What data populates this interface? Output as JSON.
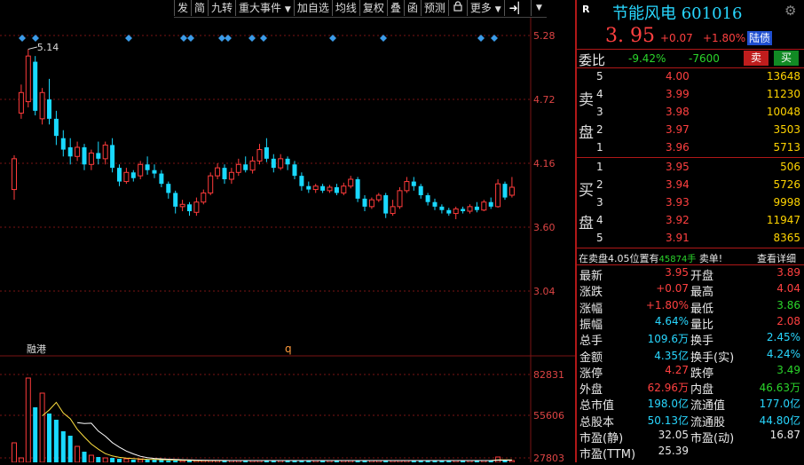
{
  "toolbar": {
    "items": [
      "发",
      "简",
      "九转",
      "重大事件",
      "加自选",
      "均线",
      "复权",
      "叠",
      "函",
      "预测",
      "",
      "更多"
    ],
    "dropdown_icon": "caret-down-icon",
    "lock_icon": "lock-icon",
    "arrow_icon": "arrow-right-icon"
  },
  "chart": {
    "price_ticks": [
      "5.28",
      "4.72",
      "4.16",
      "3.60",
      "3.04"
    ],
    "volume_ticks": [
      "82831",
      "55606",
      "27803"
    ],
    "high_marker": "5.14",
    "bottom_label_1": "融港",
    "bottom_label_2": "q",
    "diamond_markers": [
      25,
      40,
      145,
      207,
      215,
      250,
      257,
      284,
      297,
      375,
      432,
      542,
      557
    ],
    "candles": [
      {
        "o": 3.93,
        "c": 4.2,
        "h": 4.23,
        "l": 3.84
      },
      {
        "o": 4.6,
        "c": 4.78,
        "h": 4.85,
        "l": 4.55
      },
      {
        "o": 4.7,
        "c": 5.1,
        "h": 5.16,
        "l": 4.65
      },
      {
        "o": 5.05,
        "c": 4.62,
        "h": 5.1,
        "l": 4.58
      },
      {
        "o": 4.55,
        "c": 4.78,
        "h": 4.82,
        "l": 4.5
      },
      {
        "o": 4.72,
        "c": 4.55,
        "h": 4.9,
        "l": 4.5
      },
      {
        "o": 4.55,
        "c": 4.4,
        "h": 4.62,
        "l": 4.32
      },
      {
        "o": 4.38,
        "c": 4.28,
        "h": 4.45,
        "l": 4.22
      },
      {
        "o": 4.3,
        "c": 4.22,
        "h": 4.38,
        "l": 4.15
      },
      {
        "o": 4.22,
        "c": 4.3,
        "h": 4.35,
        "l": 4.18
      },
      {
        "o": 4.3,
        "c": 4.15,
        "h": 4.33,
        "l": 4.1
      },
      {
        "o": 4.15,
        "c": 4.25,
        "h": 4.28,
        "l": 4.1
      },
      {
        "o": 4.25,
        "c": 4.2,
        "h": 4.35,
        "l": 4.15
      },
      {
        "o": 4.2,
        "c": 4.32,
        "h": 4.35,
        "l": 4.15
      },
      {
        "o": 4.32,
        "c": 4.12,
        "h": 4.38,
        "l": 4.08
      },
      {
        "o": 4.12,
        "c": 4.0,
        "h": 4.15,
        "l": 3.96
      },
      {
        "o": 4.0,
        "c": 4.08,
        "h": 4.12,
        "l": 3.98
      },
      {
        "o": 4.08,
        "c": 4.03,
        "h": 4.1,
        "l": 4.0
      },
      {
        "o": 4.05,
        "c": 4.15,
        "h": 4.18,
        "l": 4.02
      },
      {
        "o": 4.15,
        "c": 4.1,
        "h": 4.22,
        "l": 4.06
      },
      {
        "o": 4.1,
        "c": 4.07,
        "h": 4.15,
        "l": 4.03
      },
      {
        "o": 4.07,
        "c": 3.98,
        "h": 4.1,
        "l": 3.95
      },
      {
        "o": 3.98,
        "c": 3.9,
        "h": 4.0,
        "l": 3.85
      },
      {
        "o": 3.9,
        "c": 3.78,
        "h": 3.92,
        "l": 3.72
      },
      {
        "o": 3.78,
        "c": 3.8,
        "h": 3.84,
        "l": 3.74
      },
      {
        "o": 3.8,
        "c": 3.74,
        "h": 3.82,
        "l": 3.7
      },
      {
        "o": 3.73,
        "c": 3.82,
        "h": 3.86,
        "l": 3.7
      },
      {
        "o": 3.82,
        "c": 3.9,
        "h": 3.93,
        "l": 3.8
      },
      {
        "o": 3.9,
        "c": 4.05,
        "h": 4.08,
        "l": 3.88
      },
      {
        "o": 4.05,
        "c": 4.12,
        "h": 4.16,
        "l": 4.02
      },
      {
        "o": 4.12,
        "c": 4.02,
        "h": 4.15,
        "l": 3.98
      },
      {
        "o": 4.02,
        "c": 4.08,
        "h": 4.12,
        "l": 3.98
      },
      {
        "o": 4.08,
        "c": 4.15,
        "h": 4.2,
        "l": 4.05
      },
      {
        "o": 4.15,
        "c": 4.1,
        "h": 4.22,
        "l": 4.08
      },
      {
        "o": 4.1,
        "c": 4.18,
        "h": 4.22,
        "l": 4.07
      },
      {
        "o": 4.18,
        "c": 4.28,
        "h": 4.33,
        "l": 4.15
      },
      {
        "o": 4.3,
        "c": 4.2,
        "h": 4.38,
        "l": 4.17
      },
      {
        "o": 4.2,
        "c": 4.12,
        "h": 4.24,
        "l": 4.08
      },
      {
        "o": 4.12,
        "c": 4.2,
        "h": 4.24,
        "l": 4.1
      },
      {
        "o": 4.2,
        "c": 4.15,
        "h": 4.22,
        "l": 4.1
      },
      {
        "o": 4.15,
        "c": 4.05,
        "h": 4.18,
        "l": 4.02
      },
      {
        "o": 4.05,
        "c": 3.96,
        "h": 4.08,
        "l": 3.92
      },
      {
        "o": 3.96,
        "c": 3.93,
        "h": 4.0,
        "l": 3.9
      },
      {
        "o": 3.93,
        "c": 3.96,
        "h": 3.98,
        "l": 3.9
      },
      {
        "o": 3.96,
        "c": 3.92,
        "h": 3.98,
        "l": 3.9
      },
      {
        "o": 3.92,
        "c": 3.95,
        "h": 3.97,
        "l": 3.9
      },
      {
        "o": 3.95,
        "c": 3.9,
        "h": 3.98,
        "l": 3.88
      },
      {
        "o": 3.9,
        "c": 3.96,
        "h": 3.99,
        "l": 3.88
      },
      {
        "o": 3.96,
        "c": 4.02,
        "h": 4.05,
        "l": 3.94
      },
      {
        "o": 4.02,
        "c": 3.85,
        "h": 4.04,
        "l": 3.82
      },
      {
        "o": 3.85,
        "c": 3.78,
        "h": 3.88,
        "l": 3.74
      },
      {
        "o": 3.78,
        "c": 3.84,
        "h": 3.86,
        "l": 3.76
      },
      {
        "o": 3.84,
        "c": 3.88,
        "h": 3.9,
        "l": 3.82
      },
      {
        "o": 3.88,
        "c": 3.72,
        "h": 3.9,
        "l": 3.68
      },
      {
        "o": 3.72,
        "c": 3.78,
        "h": 3.84,
        "l": 3.7
      },
      {
        "o": 3.78,
        "c": 3.92,
        "h": 3.95,
        "l": 3.76
      },
      {
        "o": 3.92,
        "c": 4.0,
        "h": 4.04,
        "l": 3.9
      },
      {
        "o": 4.0,
        "c": 3.96,
        "h": 4.04,
        "l": 3.92
      },
      {
        "o": 3.96,
        "c": 3.88,
        "h": 3.98,
        "l": 3.85
      },
      {
        "o": 3.88,
        "c": 3.82,
        "h": 3.9,
        "l": 3.79
      },
      {
        "o": 3.82,
        "c": 3.78,
        "h": 3.85,
        "l": 3.75
      },
      {
        "o": 3.78,
        "c": 3.75,
        "h": 3.8,
        "l": 3.72
      },
      {
        "o": 3.75,
        "c": 3.72,
        "h": 3.77,
        "l": 3.7
      },
      {
        "o": 3.72,
        "c": 3.76,
        "h": 3.78,
        "l": 3.67
      },
      {
        "o": 3.76,
        "c": 3.74,
        "h": 3.78,
        "l": 3.72
      },
      {
        "o": 3.74,
        "c": 3.78,
        "h": 3.8,
        "l": 3.72
      },
      {
        "o": 3.78,
        "c": 3.75,
        "h": 3.82,
        "l": 3.73
      },
      {
        "o": 3.75,
        "c": 3.82,
        "h": 3.84,
        "l": 3.74
      },
      {
        "o": 3.82,
        "c": 3.78,
        "h": 3.86,
        "l": 3.76
      },
      {
        "o": 3.78,
        "c": 3.98,
        "h": 4.02,
        "l": 3.77
      },
      {
        "o": 3.98,
        "c": 3.86,
        "h": 4.0,
        "l": 3.84
      },
      {
        "o": 3.88,
        "c": 3.95,
        "h": 4.04,
        "l": 3.86
      }
    ],
    "volumes": [
      0.22,
      0.05,
      0.95,
      0.62,
      0.78,
      0.55,
      0.48,
      0.35,
      0.3,
      0.18,
      0.12,
      0.08,
      0.06,
      0.05,
      0.05,
      0.04,
      0.04,
      0.03,
      0.03,
      0.03,
      0.03,
      0.03,
      0.02,
      0.02,
      0.02,
      0.02,
      0.02,
      0.02,
      0.02,
      0.02,
      0.02,
      0.02,
      0.02,
      0.02,
      0.02,
      0.02,
      0.02,
      0.02,
      0.02,
      0.02,
      0.02,
      0.02,
      0.02,
      0.02,
      0.02,
      0.02,
      0.02,
      0.02,
      0.02,
      0.02,
      0.02,
      0.02,
      0.02,
      0.02,
      0.02,
      0.02,
      0.02,
      0.02,
      0.02,
      0.02,
      0.02,
      0.02,
      0.02,
      0.02,
      0.02,
      0.02,
      0.02,
      0.02,
      0.02,
      0.06,
      0.02,
      0.02
    ]
  },
  "quote": {
    "badge": "R",
    "name_code": "节能风电 601016",
    "price": "3. 95",
    "change": "+0.07",
    "change_pct": "+1.80%",
    "tag": "陆债",
    "settings_icon": "gear-icon",
    "weibi_label": "委比",
    "weibi_value": "-9.42%",
    "weicha_value": "-7600",
    "sell_button": "卖",
    "buy_button": "买",
    "sell_label": [
      "卖",
      "盘"
    ],
    "buy_label": [
      "买",
      "盘"
    ],
    "asks": [
      {
        "level": "5",
        "price": "4.00",
        "vol": "13648"
      },
      {
        "level": "4",
        "price": "3.99",
        "vol": "11230"
      },
      {
        "level": "3",
        "price": "3.98",
        "vol": "10048"
      },
      {
        "level": "2",
        "price": "3.97",
        "vol": "3503"
      },
      {
        "level": "1",
        "price": "3.96",
        "vol": "5713"
      }
    ],
    "bids": [
      {
        "level": "1",
        "price": "3.95",
        "vol": "506"
      },
      {
        "level": "2",
        "price": "3.94",
        "vol": "5726"
      },
      {
        "level": "3",
        "price": "3.93",
        "vol": "9998"
      },
      {
        "level": "4",
        "price": "3.92",
        "vol": "11947"
      },
      {
        "level": "5",
        "price": "3.91",
        "vol": "8365"
      }
    ],
    "notice_prefix": "在卖盘4.05位置有",
    "notice_num": "45874手",
    "notice_suffix": "卖单!",
    "notice_link": "查看详细",
    "stats": [
      {
        "l1": "最新",
        "v1": "3.95",
        "c1": "red",
        "l2": "开盘",
        "v2": "3.89",
        "c2": "red"
      },
      {
        "l1": "涨跌",
        "v1": "+0.07",
        "c1": "red",
        "l2": "最高",
        "v2": "4.04",
        "c2": "red"
      },
      {
        "l1": "涨幅",
        "v1": "+1.80%",
        "c1": "red",
        "l2": "最低",
        "v2": "3.86",
        "c2": "green"
      },
      {
        "l1": "振幅",
        "v1": "4.64%",
        "c1": "cyan",
        "l2": "量比",
        "v2": "2.08",
        "c2": "red"
      },
      {
        "l1": "总手",
        "v1": "109.6万",
        "c1": "cyan",
        "l2": "换手",
        "v2": "2.45%",
        "c2": "cyan"
      },
      {
        "l1": "金额",
        "v1": "4.35亿",
        "c1": "cyan",
        "l2": "换手(实)",
        "v2": "4.24%",
        "c2": "cyan"
      },
      {
        "l1": "涨停",
        "v1": "4.27",
        "c1": "red",
        "l2": "跌停",
        "v2": "3.49",
        "c2": "green"
      },
      {
        "l1": "外盘",
        "v1": "62.96万",
        "c1": "red",
        "l2": "内盘",
        "v2": "46.63万",
        "c2": "green"
      },
      {
        "l1": "总市值",
        "v1": "198.0亿",
        "c1": "cyan",
        "l2": "流通值",
        "v2": "177.0亿",
        "c2": "cyan"
      },
      {
        "l1": "总股本",
        "v1": "50.13亿",
        "c1": "cyan",
        "l2": "流通股",
        "v2": "44.80亿",
        "c2": "cyan"
      },
      {
        "l1": "市盈(静)",
        "v1": "32.05",
        "c1": "white",
        "l2": "市盈(动)",
        "v2": "16.87",
        "c2": "white"
      },
      {
        "l1": "市盈(TTM)",
        "v1": "25.39",
        "c1": "white",
        "l2": "",
        "v2": "",
        "c2": "white"
      }
    ]
  },
  "colors": {
    "up": "#ff3b3b",
    "down": "#19d9ff",
    "grid": "#7a1414",
    "panel_line": "#b01818",
    "marker": "#3b9be8"
  }
}
